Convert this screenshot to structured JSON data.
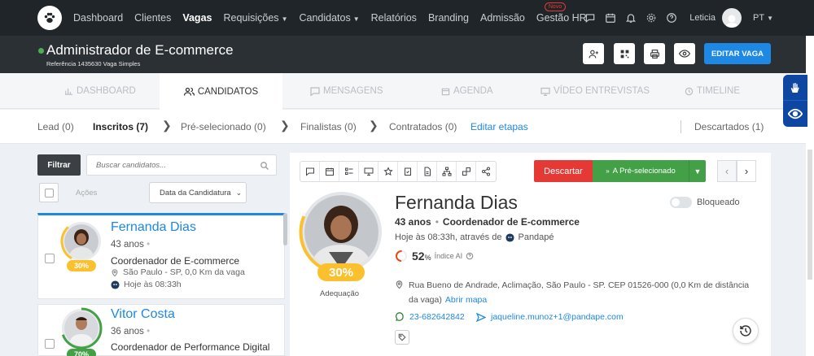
{
  "topnav": {
    "items": [
      "Dashboard",
      "Clientes",
      "Vagas",
      "Requisições",
      "Candidatos",
      "Relatórios",
      "Branding",
      "Admissão",
      "Gestão HR"
    ],
    "new_badge": "Novo",
    "user": "Leticia",
    "lang": "PT"
  },
  "job": {
    "title": "Administrador de E-commerce",
    "reference": "Referência 1435630 Vaga Simples",
    "edit_label": "EDITAR VAGA"
  },
  "tabs": [
    "DASHBOARD",
    "CANDIDATOS",
    "MENSAGENS",
    "AGENDA",
    "VÍDEO ENTREVISTAS",
    "TIMELINE"
  ],
  "stages": {
    "lead": "Lead (0)",
    "inscritos": "Inscritos (7)",
    "preselecionado": "Pré-selecionado (0)",
    "finalistas": "Finalistas (0)",
    "contratados": "Contratados (0)",
    "edit": "Editar etapas",
    "descartados": "Descartados (1)"
  },
  "list": {
    "filter_label": "Filtrar",
    "search_placeholder": "Buscar candidatos...",
    "actions_label": "Ações",
    "sort_label": "Data da Candidatura"
  },
  "candidates": [
    {
      "name": "Fernanda Dias",
      "age": "43 anos",
      "role": "Coordenador de E-commerce",
      "location": "São Paulo - SP, 0,0 Km da vaga",
      "applied": "Hoje às 08:33h",
      "score": "30%",
      "score_value": 30
    },
    {
      "name": "Vitor Costa",
      "age": "36 anos",
      "role": "Coordenador de Performance Digital",
      "score": "70%",
      "score_value": 70
    }
  ],
  "detail": {
    "discard_label": "Descartar",
    "advance_label": "A Pré-selecionado",
    "name": "Fernanda Dias",
    "age": "43 anos",
    "role": "Coordenador de E-commerce",
    "applied": "Hoje às 08:33h, através de",
    "source": "Pandapé",
    "ai_score": "52",
    "ai_pct_sign": "%",
    "ai_label": "Índice AI",
    "ai_value": 52,
    "score": "30%",
    "score_value": 30,
    "score_label": "Adequação",
    "blocked_label": "Bloqueado",
    "address": "Rua Bueno de Andrade, Aclimação, São Paulo - SP. CEP 01526-000 (0,0 Km de distância da vaga)",
    "map_link": "Abrir mapa",
    "phone": "23-682642842",
    "email": "jaqueline.munoz+1@pandape.com"
  },
  "colors": {
    "accent": "#1e88e5",
    "discard": "#e53935",
    "advance": "#43a047",
    "score": "#fbc02d"
  }
}
